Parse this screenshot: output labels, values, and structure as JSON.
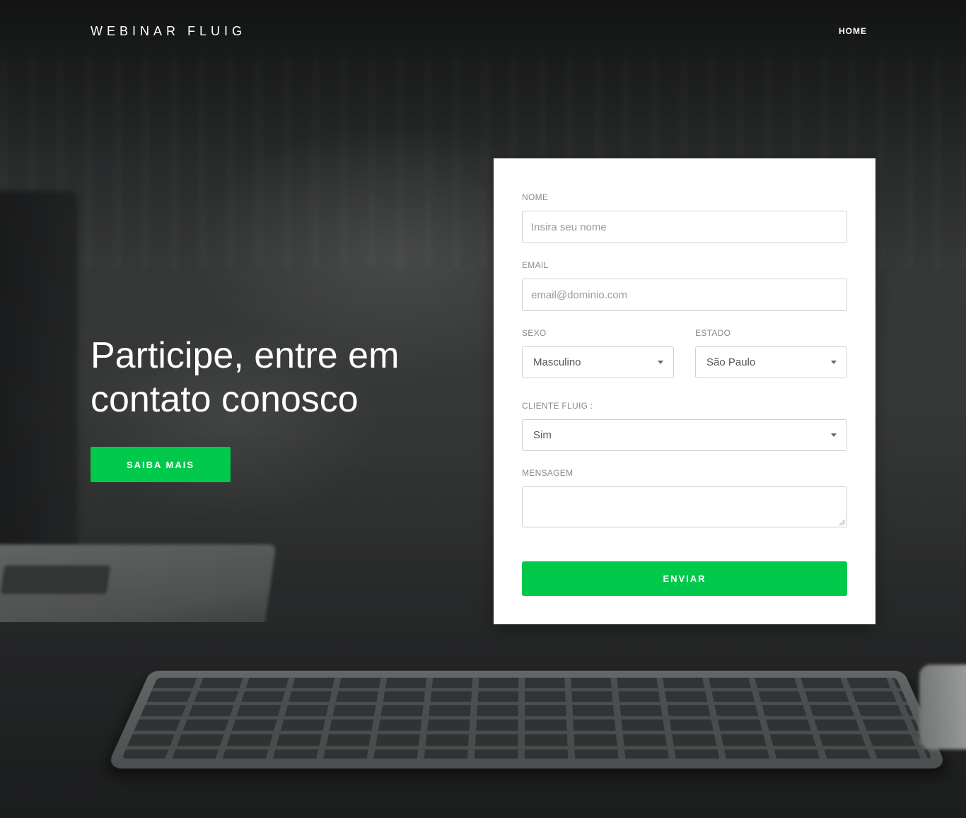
{
  "header": {
    "brand": "WEBINAR FLUIG",
    "nav": {
      "home": "HOME"
    }
  },
  "hero": {
    "title_line1": "Participe, entre em",
    "title_line2": "contato conosco",
    "cta_label": "SAIBA MAIS"
  },
  "form": {
    "name": {
      "label": "NOME",
      "placeholder": "Insira seu nome",
      "value": ""
    },
    "email": {
      "label": "EMAIL",
      "placeholder": "email@dominio.com",
      "value": ""
    },
    "sexo": {
      "label": "SEXO",
      "selected": "Masculino"
    },
    "estado": {
      "label": "ESTADO",
      "selected": "São Paulo"
    },
    "cliente": {
      "label": "CLIENTE FLUIG :",
      "selected": "Sim"
    },
    "mensagem": {
      "label": "MENSAGEM",
      "value": ""
    },
    "submit_label": "ENVIAR"
  },
  "colors": {
    "accent": "#00c94c",
    "card_bg": "#ffffff",
    "label_gray": "#8a8a8a"
  },
  "icons": {
    "select_caret": "chevron-down-icon"
  }
}
